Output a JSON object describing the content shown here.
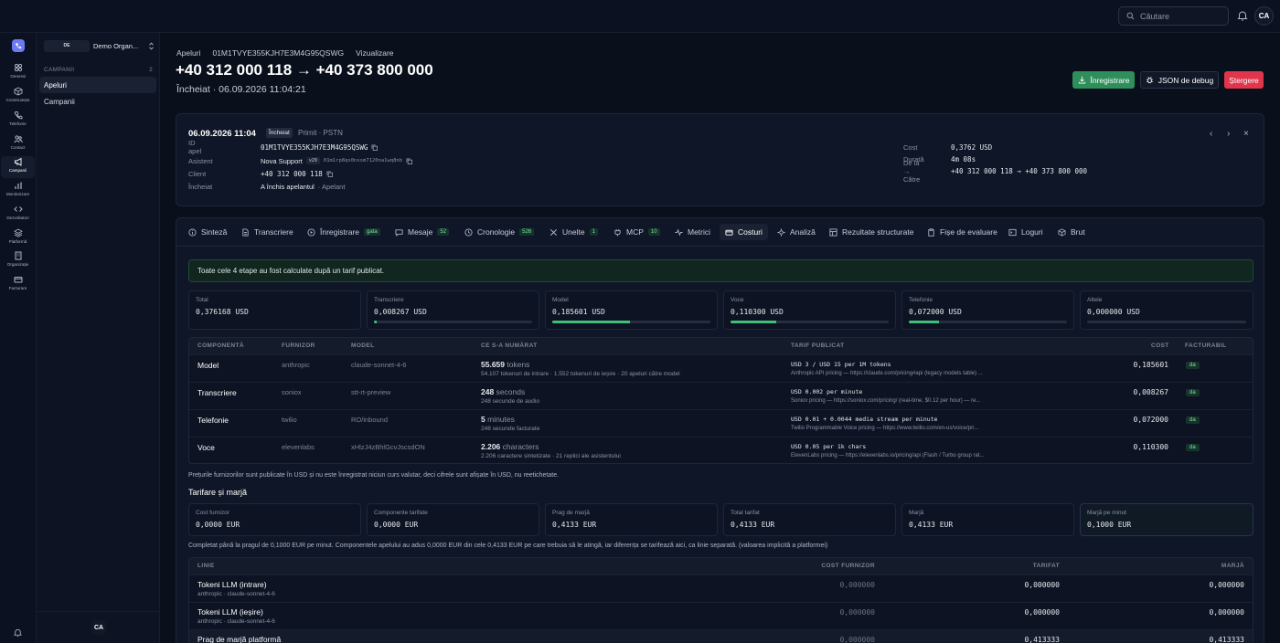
{
  "topbar": {
    "search_placeholder": "Căutare",
    "avatar": "CA"
  },
  "rail": {
    "items": [
      "General",
      "Construiește",
      "Telefonie",
      "Contact",
      "Campanii",
      "Monitorizare",
      "Dezvoltatori",
      "Platformă",
      "Organizație",
      "Facturare"
    ],
    "active": "Campanii"
  },
  "sidenav": {
    "org_badge": "DE",
    "org_name": "Demo Organ...",
    "section_label": "CAMPANII",
    "section_count": "2",
    "items": [
      "Apeluri",
      "Campanii"
    ],
    "avatar": "CA"
  },
  "header": {
    "crumbs": [
      "Apeluri",
      "01M1TVYE355KJH7E3M4G95QSWG",
      "Vizualizare"
    ],
    "title": "+40 312 000 118 → +40 373 800 000",
    "subtitle": "Încheiat · 06.09.2026 11:04:21",
    "btn_record": "Înregistrare",
    "btn_json": "JSON de debug",
    "btn_delete": "Ștergere"
  },
  "call": {
    "date": "06.09.2026 11:04",
    "status_badge": "Încheiat",
    "meta": "Primit · PSTN",
    "left": [
      {
        "k": "ID apel",
        "v": "01M1TVYE355KJH7E3M4G95QSWG",
        "mono": true,
        "copy": true
      },
      {
        "k": "Asistent",
        "v": "Nova Support",
        "chip": "v29",
        "extra": "01m1rp8qs0nssm7120na1wq8nb",
        "copy": true
      },
      {
        "k": "Client",
        "v": "+40 312 000 118",
        "mono": true,
        "copy": true
      },
      {
        "k": "Încheiat",
        "v": "A închis apelantul",
        "extra2": "· Apelant"
      }
    ],
    "right": [
      {
        "k": "Cost",
        "v": "0,3762 USD"
      },
      {
        "k": "Durată",
        "v": "4m 08s"
      },
      {
        "k": "De la → Către",
        "v": "+40 312 000 118 → +40 373 800 000"
      }
    ]
  },
  "tabs": [
    {
      "label": "Sinteză",
      "icon": "info-icon"
    },
    {
      "label": "Transcriere",
      "icon": "document-icon"
    },
    {
      "label": "Înregistrare",
      "icon": "play-icon",
      "badge": "gata"
    },
    {
      "label": "Mesaje",
      "icon": "message-icon",
      "badge": "52"
    },
    {
      "label": "Cronologie",
      "icon": "clock-icon",
      "badge": "526"
    },
    {
      "label": "Unelte",
      "icon": "tools-icon",
      "badge": "1"
    },
    {
      "label": "MCP",
      "icon": "plug-icon",
      "badge": "10"
    },
    {
      "label": "Metrici",
      "icon": "activity-icon"
    },
    {
      "label": "Costuri",
      "icon": "wallet-icon",
      "active": true
    },
    {
      "label": "Analiză",
      "icon": "sparkle-icon"
    },
    {
      "label": "Rezultate structurate",
      "icon": "grid-icon"
    },
    {
      "label": "Fișe de evaluare",
      "icon": "clipboard-icon"
    },
    {
      "label": "Loguri",
      "icon": "terminal-icon"
    },
    {
      "label": "Brut",
      "icon": "box-icon"
    }
  ],
  "costs": {
    "banner": "Toate cele 4 etape au fost calculate după un tarif publicat.",
    "stats": [
      {
        "label": "Total",
        "value": "0,376168 USD"
      },
      {
        "label": "Transcriere",
        "value": "0,008267 USD",
        "fill": 0.02
      },
      {
        "label": "Model",
        "value": "0,185601 USD",
        "fill": 0.49
      },
      {
        "label": "Voce",
        "value": "0,110300 USD",
        "fill": 0.29
      },
      {
        "label": "Telefonie",
        "value": "0,072000 USD",
        "fill": 0.19
      },
      {
        "label": "Altele",
        "value": "0,000000 USD",
        "fill": 0
      }
    ],
    "table_headers": [
      "COMPONENTĂ",
      "FURNIZOR",
      "MODEL",
      "CE S-A NUMĂRAT",
      "TARIF PUBLICAT",
      "COST",
      "FACTURABIL"
    ],
    "rows": [
      {
        "comp": "Model",
        "prov": "anthropic",
        "model": "claude-sonnet-4-6",
        "qty": "55.659",
        "unit": "tokens",
        "detail": "54.107 tokenuri de intrare · 1.552 tokenuri de ieșire · 20 apeluri către model",
        "tariff": "USD 3 / USD 15 per 1M tokens",
        "source": "Anthropic API pricing — https://claude.com/pricing#api (legacy models table) ...",
        "cost": "0,185601",
        "bill": "da"
      },
      {
        "comp": "Transcriere",
        "prov": "soniox",
        "model": "stt-rt-preview",
        "qty": "248",
        "unit": "seconds",
        "detail": "248 secunde de audio",
        "tariff": "USD 0.002 per minute",
        "source": "Soniox pricing — https://soniox.com/pricing/ (real-time, $0.12 per hour) — re...",
        "cost": "0,008267",
        "bill": "da"
      },
      {
        "comp": "Telefonie",
        "prov": "twilio",
        "model": "RO/inbound",
        "qty": "5",
        "unit": "minutes",
        "detail": "248 secunde facturate",
        "tariff": "USD 0.01 + 0.0044 media stream per minute",
        "source": "Twilio Programmable Voice pricing — https://www.twilio.com/en-us/voice/pri...",
        "cost": "0,072000",
        "bill": "da"
      },
      {
        "comp": "Voce",
        "prov": "elevenlabs",
        "model": "xHlzJ4zBhlGcvJscsdON",
        "qty": "2.206",
        "unit": "characters",
        "detail": "2.206 caractere sintetizate · 21 replici ale asistentului",
        "tariff": "USD 0.05 per 1k chars",
        "source": "ElevenLabs pricing — https://elevenlabs.io/pricing/api (Flash / Turbo group rat...",
        "cost": "0,110300",
        "bill": "da"
      }
    ],
    "note1": "Prețurile furnizorilor sunt publicate în USD și nu este înregistrat niciun curs valutar, deci cifrele sunt afișate în USD, nu reetichetate.",
    "billing_title": "Tarifare și marjă",
    "billing_stats": [
      {
        "label": "Cost furnizor",
        "value": "0,0000 EUR"
      },
      {
        "label": "Componente tarifate",
        "value": "0,0000 EUR"
      },
      {
        "label": "Prag de marjă",
        "value": "0,4133 EUR"
      },
      {
        "label": "Total tarifat",
        "value": "0,4133 EUR"
      },
      {
        "label": "Marjă",
        "value": "0,4133 EUR"
      },
      {
        "label": "Marjă pe minut",
        "value": "0,1000 EUR"
      }
    ],
    "note2": "Completat până la pragul de 0,1000 EUR pe minut. Componentele apelului au adus 0,0000 EUR din cele 0,4133 EUR pe care trebuia să le atingă, iar diferența se tarifează aici, ca linie separată. (valoarea implicită a platformei)",
    "line_headers": [
      "LINIE",
      "COST FURNIZOR",
      "TARIFAT",
      "MARJĂ"
    ],
    "lines": [
      {
        "name": "Tokeni LLM (intrare)",
        "sub": "anthropic · claude-sonnet-4-6",
        "cost": "0,000000",
        "billed": "0,000000",
        "margin": "0,000000"
      },
      {
        "name": "Tokeni LLM (ieșire)",
        "sub": "anthropic · claude-sonnet-4-6",
        "cost": "0,000000",
        "billed": "0,000000",
        "margin": "0,000000"
      },
      {
        "name": "Prag de marjă platformă",
        "sub": "",
        "cost": "0,000000",
        "billed": "0,413333",
        "margin": "0,413333"
      }
    ]
  }
}
